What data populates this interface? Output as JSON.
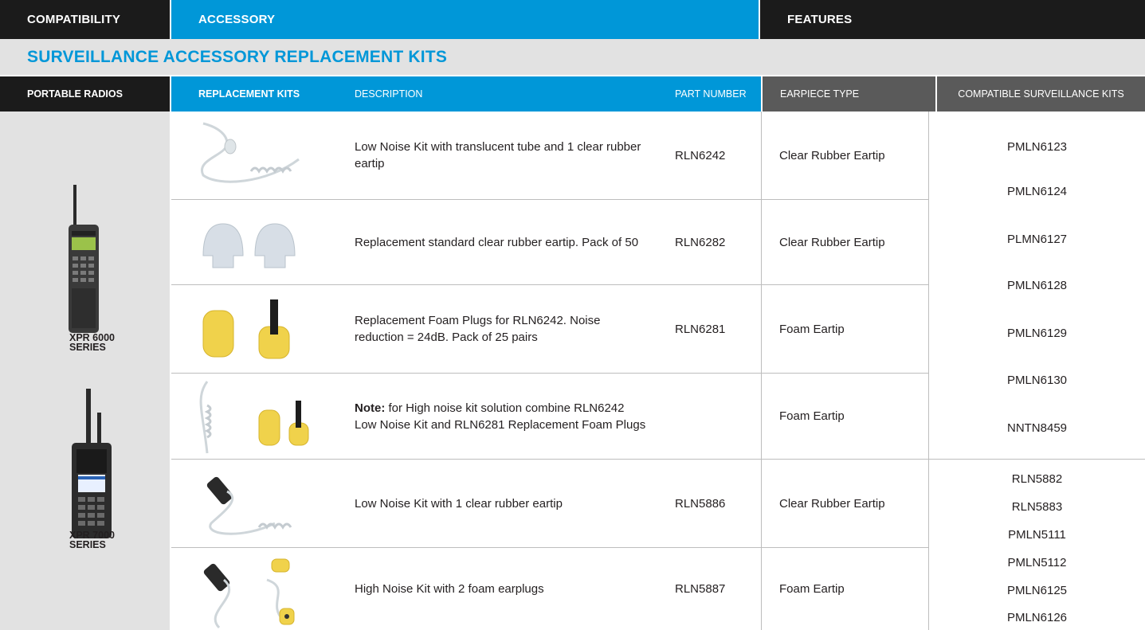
{
  "top_bar": {
    "compatibility": "COMPATIBILITY",
    "accessory": "ACCESSORY",
    "features": "FEATURES"
  },
  "section_title": "SURVEILLANCE ACCESSORY REPLACEMENT KITS",
  "sub_headers": {
    "portable_radios": "PORTABLE RADIOS",
    "replacement_kits": "REPLACEMENT KITS",
    "description": "DESCRIPTION",
    "part_number": "PART NUMBER",
    "earpiece_type": "EARPIECE TYPE",
    "compatible_kits": "COMPATIBLE SURVEILLANCE KITS"
  },
  "radios": [
    {
      "line1": "XPR 6000",
      "line2": "SERIES"
    },
    {
      "line1": "XPR 7000",
      "line2": "SERIES"
    }
  ],
  "rows": [
    {
      "description": "Low Noise Kit with translucent tube and 1 clear rubber eartip",
      "part": "RLN6242",
      "earpiece": "Clear Rubber Eartip",
      "image": "translucent-tube-icon"
    },
    {
      "description": "Replacement standard clear rubber eartip. Pack of 50",
      "part": "RLN6282",
      "earpiece": "Clear Rubber Eartip",
      "image": "rubber-eartips-icon"
    },
    {
      "description": "Replacement Foam Plugs for RLN6242. Noise reduction = 24dB. Pack of 25 pairs",
      "part": "RLN6281",
      "earpiece": "Foam Eartip",
      "image": "foam-plugs-icon"
    },
    {
      "description_bold": "Note:",
      "description": " for High noise kit solution combine RLN6242 Low Noise Kit and RLN6281 Replacement Foam Plugs",
      "part": "",
      "earpiece": "Foam Eartip",
      "image": "tube-and-foam-icon"
    },
    {
      "description": "Low Noise Kit with 1 clear rubber eartip",
      "part": "RLN5886",
      "earpiece": "Clear Rubber Eartip",
      "image": "coiled-tube-icon"
    },
    {
      "description": "High Noise Kit with 2 foam earplugs",
      "part": "RLN5887",
      "earpiece": "Foam Eartip",
      "image": "coiled-tube-foam-icon"
    }
  ],
  "compat_group_1": [
    "PMLN6123",
    "PMLN6124",
    "PLMN6127",
    "PMLN6128",
    "PMLN6129",
    "PMLN6130",
    "NNTN8459"
  ],
  "compat_group_2": [
    "RLN5882",
    "RLN5883",
    "PMLN5111",
    "PMLN5112",
    "PMLN6125",
    "PMLN6126"
  ],
  "colors": {
    "accent_blue": "#0097d8",
    "header_dark": "#1b1b1b",
    "header_grey": "#5a5a5a",
    "panel_grey": "#e2e2e2"
  }
}
